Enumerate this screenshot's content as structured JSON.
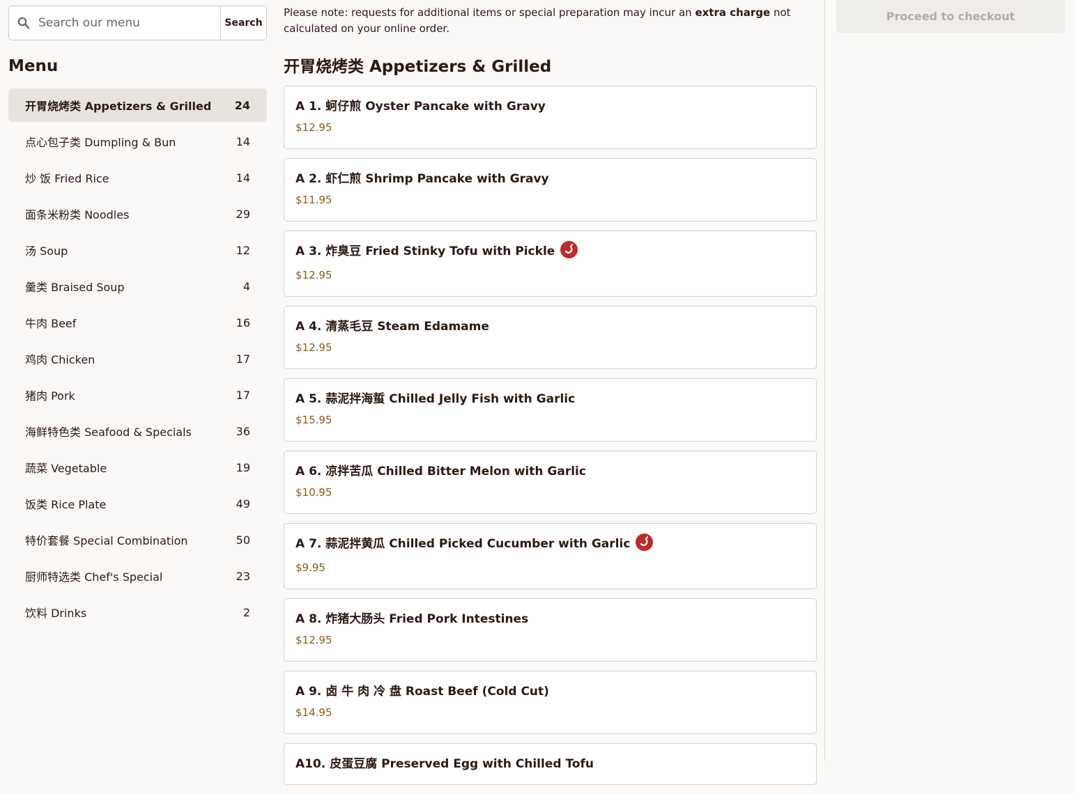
{
  "search": {
    "placeholder": "Search our menu",
    "button_label": "Search"
  },
  "sidebar": {
    "title": "Menu",
    "categories": [
      {
        "label": "开胃烧烤类 Appetizers & Grilled",
        "count": "24",
        "active": true
      },
      {
        "label": "点心包子类 Dumpling & Bun",
        "count": "14"
      },
      {
        "label": "炒 饭 Fried Rice",
        "count": "14"
      },
      {
        "label": "面条米粉类 Noodles",
        "count": "29"
      },
      {
        "label": "汤 Soup",
        "count": "12"
      },
      {
        "label": "羹类 Braised Soup",
        "count": "4"
      },
      {
        "label": "牛肉 Beef",
        "count": "16"
      },
      {
        "label": "鸡肉 Chicken",
        "count": "17"
      },
      {
        "label": "猪肉 Pork",
        "count": "17"
      },
      {
        "label": "海鲜特色类 Seafood & Specials",
        "count": "36"
      },
      {
        "label": "蔬菜 Vegetable",
        "count": "19"
      },
      {
        "label": "饭类 Rice Plate",
        "count": "49"
      },
      {
        "label": "特价套餐 Special Combination",
        "count": "50"
      },
      {
        "label": "厨师特选类 Chef's Special",
        "count": "23"
      },
      {
        "label": "饮料 Drinks",
        "count": "2"
      }
    ]
  },
  "note": {
    "before": "Please note: requests for additional items or special preparation may incur an ",
    "bold": "extra charge",
    "after": " not calculated on your online order."
  },
  "section": {
    "title": "开胃烧烤类 Appetizers & Grilled"
  },
  "items": [
    {
      "name": "A 1. 蚵仔煎 Oyster Pancake with Gravy",
      "price": "$12.95",
      "spicy": false
    },
    {
      "name": "A 2. 虾仁煎 Shrimp Pancake with Gravy",
      "price": "$11.95",
      "spicy": false
    },
    {
      "name": "A 3. 炸臭豆 Fried Stinky Tofu with Pickle",
      "price": "$12.95",
      "spicy": true
    },
    {
      "name": "A 4. 清蒸毛豆 Steam Edamame",
      "price": "$12.95",
      "spicy": false
    },
    {
      "name": "A 5. 蒜泥拌海蜇 Chilled Jelly Fish with Garlic",
      "price": "$15.95",
      "spicy": false
    },
    {
      "name": "A 6. 凉拌苦瓜 Chilled Bitter Melon with Garlic",
      "price": "$10.95",
      "spicy": false
    },
    {
      "name": "A 7. 蒜泥拌黄瓜 Chilled Picked Cucumber with Garlic",
      "price": "$9.95",
      "spicy": true
    },
    {
      "name": "A 8. 炸猪大肠头 Fried Pork Intestines",
      "price": "$12.95",
      "spicy": false
    },
    {
      "name": "A 9. 卤 牛 肉 冷 盘 Roast Beef (Cold Cut)",
      "price": "$14.95",
      "spicy": false
    },
    {
      "name": "A10. 皮蛋豆腐 Preserved Egg with Chilled Tofu",
      "price": "",
      "spicy": false
    }
  ],
  "checkout": {
    "label": "Proceed to checkout"
  },
  "icons": {
    "search": "search-icon",
    "spicy": "chili-pepper-icon"
  },
  "colors": {
    "spicy": "#c0282a",
    "price": "#8a5c16",
    "active_bg": "#e7e4e0"
  }
}
